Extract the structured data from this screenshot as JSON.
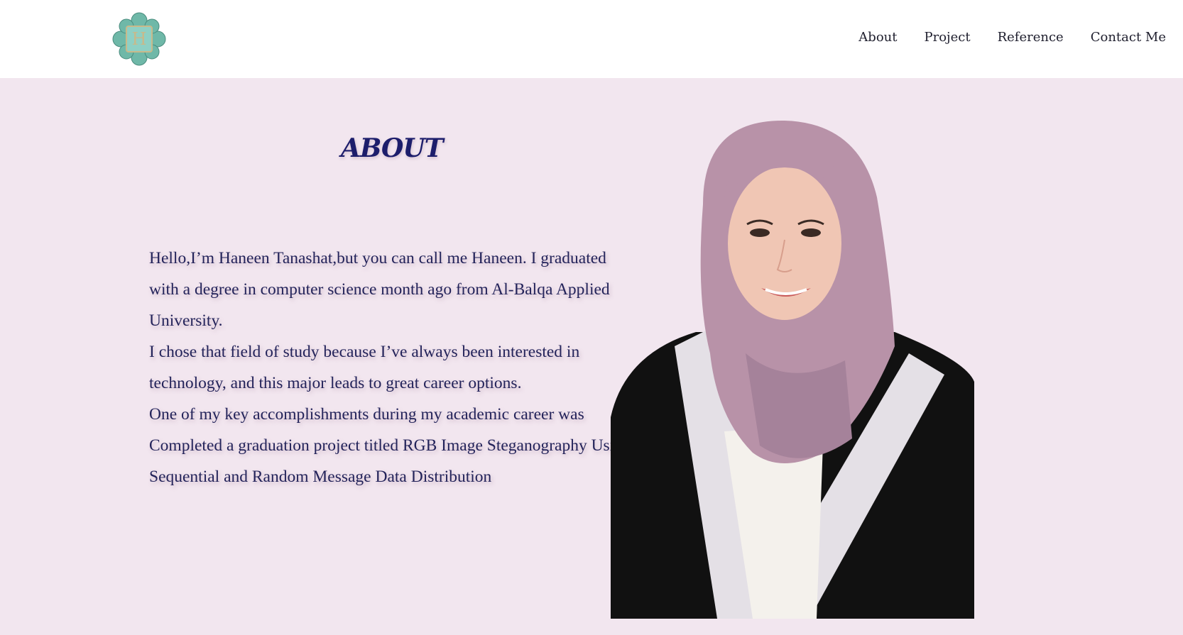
{
  "header": {
    "logo_letter": "H",
    "nav": [
      {
        "label": "About"
      },
      {
        "label": "Project"
      },
      {
        "label": "Reference"
      },
      {
        "label": "Contact Me"
      }
    ]
  },
  "about": {
    "title": "ABOUT",
    "paragraphs": [
      "Hello,I’m Haneen Tanashat,but you can call me Haneen. I graduated with a degree in computer science month ago from Al-Balqa Applied University.",
      "I chose that field of study because I’ve always been interested in technology, and this major leads to great career options.",
      "One of my key accomplishments during my academic career was Completed a graduation project titled RGB Image Steganography Using Sequential and Random Message Data Distribution"
    ]
  },
  "colors": {
    "page_background": "#f2e6ef",
    "title": "#1c1d6b",
    "body_text": "#23235a",
    "hijab": "#b892a8",
    "gown": "#111111"
  }
}
